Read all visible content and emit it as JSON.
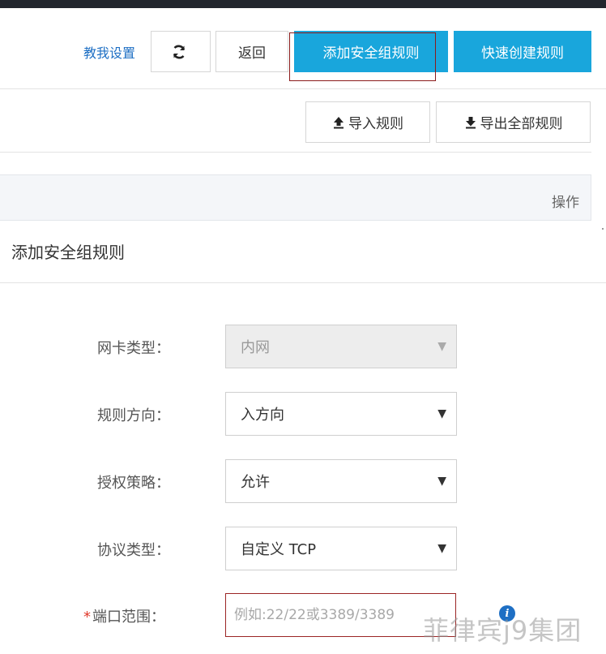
{
  "toolbar": {
    "help_link": "教我设置",
    "back_label": "返回",
    "add_rule_label": "添加安全组规则",
    "quick_create_label": "快速创建规则"
  },
  "actions": {
    "import_label": "导入规则",
    "export_label": "导出全部规则"
  },
  "table": {
    "operations_header": "操作"
  },
  "dialog": {
    "title": "添加安全组规则",
    "fields": {
      "nic_type": {
        "label": "网卡类型：",
        "value": "内网"
      },
      "direction": {
        "label": "规则方向：",
        "value": "入方向"
      },
      "policy": {
        "label": "授权策略：",
        "value": "允许"
      },
      "protocol": {
        "label": "协议类型：",
        "value": "自定义 TCP"
      },
      "port_range": {
        "label": "端口范围：",
        "required_mark": "*",
        "placeholder": "例如:22/22或3389/3389"
      }
    }
  },
  "watermark": "菲律宾j9集团",
  "icons": {
    "refresh": "refresh-icon",
    "upload": "upload-icon",
    "download": "download-icon",
    "caret": "caret-down-icon",
    "info": "info-icon"
  },
  "colors": {
    "primary": "#19a6dc",
    "link": "#1e6fc4",
    "highlight": "#8b1a1a",
    "topbar": "#23262e"
  }
}
